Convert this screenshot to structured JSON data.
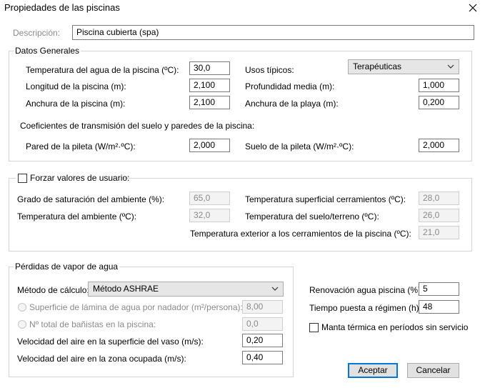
{
  "window": {
    "title": "Propiedades de las piscinas"
  },
  "description": {
    "label": "Descripción:",
    "value": "Piscina cubierta (spa)"
  },
  "general": {
    "title": "Datos Generales",
    "water_temp": {
      "label": "Temperatura del agua de la piscina (ºC):",
      "value": "30,0"
    },
    "length": {
      "label": "Longitud de la piscina (m):",
      "value": "2,100"
    },
    "width": {
      "label": "Anchura de la piscina (m):",
      "value": "2,100"
    },
    "typical_uses": {
      "label": "Usos típicos:",
      "selected": "Terapéuticas"
    },
    "depth": {
      "label": "Profundidad media (m):",
      "value": "1,000"
    },
    "beach_width": {
      "label": "Anchura de la playa (m):",
      "value": "0,200"
    },
    "coef_title": "Coeficientes de transmisión del suelo y paredes de la piscina:",
    "wall": {
      "label": "Pared de la pileta (W/m²·ºC):",
      "value": "2,000"
    },
    "floor": {
      "label": "Suelo de la pileta (W/m²·ºC):",
      "value": "2,000"
    }
  },
  "force": {
    "checkbox_label": "Forzar valores de usuario:",
    "checked": false,
    "saturation": {
      "label": "Grado de saturación del ambiente  (%):",
      "value": "65,0"
    },
    "ambient_temp": {
      "label": "Temperatura del ambiente (ºC):",
      "value": "32,0"
    },
    "surface_temp": {
      "label": "Temperatura superficial cerramientos (ºC):",
      "value": "28,0"
    },
    "soil_temp": {
      "label": "Temperatura del  suelo/terreno (ºC):",
      "value": "26,0"
    },
    "exterior_temp": {
      "label": "Temperatura exterior a los cerramientos de la piscina (ºC):",
      "value": "21,0"
    }
  },
  "vapor": {
    "title": "Pérdidas de vapor de agua",
    "method": {
      "label": "Método de cálculo:",
      "selected": "Método ASHRAE"
    },
    "surface_per_swimmer": {
      "label": "Superficie de lámina de agua por nadador (m²/persona):",
      "value": "8,00"
    },
    "total_bathers": {
      "label": "Nº total de bañistas en la piscina:",
      "value": "0,0"
    },
    "air_speed_surface": {
      "label": "Velocidad del aire en la superficie del vaso (m/s):",
      "value": "0,20"
    },
    "air_speed_zone": {
      "label": "Velocidad del aire en la zona ocupada (m/s):",
      "value": "0,40"
    }
  },
  "renewal": {
    "label": "Renovación agua piscina (%):",
    "value": "5"
  },
  "startup": {
    "label": "Tiempo puesta a régimen (h):",
    "value": "48"
  },
  "thermal_blanket": {
    "label": "Manta térmica en períodos sin servicio",
    "checked": false
  },
  "buttons": {
    "accept": "Aceptar",
    "cancel": "Cancelar"
  },
  "colors": {
    "accent": "#0078d7",
    "disabled_text": "#8a8a8a"
  },
  "icons": {
    "close": "close-icon",
    "dropdown": "chevron-down-icon"
  }
}
